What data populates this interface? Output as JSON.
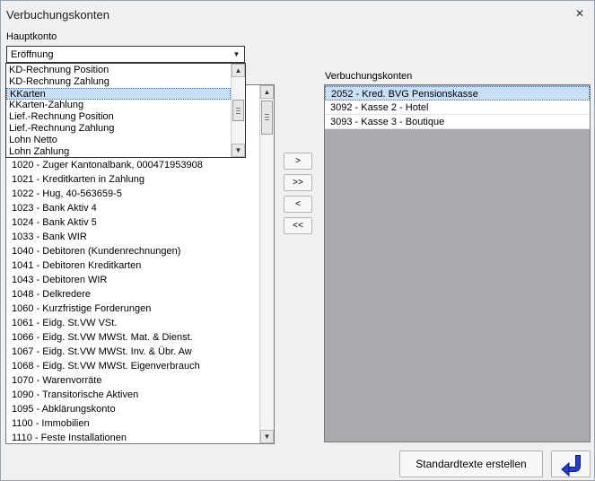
{
  "window": {
    "title": "Verbuchungskonten",
    "close_glyph": "✕"
  },
  "hauptkonto": {
    "label": "Hauptkonto",
    "selected": "Eröffnung",
    "dropdown_items": [
      "KD-Rechnung Position",
      "KD-Rechnung Zahlung",
      "KKarten",
      "KKarten-Zahlung",
      "Lief.-Rechnung Position",
      "Lief.-Rechnung Zahlung",
      "Lohn Netto",
      "Lohn Zahlung"
    ],
    "dropdown_selected_index": 2
  },
  "konten_list": {
    "items": [
      "1020 - Zuger Kantonalbank, 000471953908",
      "1021 - Kreditkarten in Zahlung",
      "1022 - Hug, 40-563659-5",
      "1023 - Bank Aktiv 4",
      "1024 - Bank Aktiv 5",
      "1033 - Bank WIR",
      "1040 - Debitoren (Kundenrechnungen)",
      "1041 - Debitoren Kreditkarten",
      "1043 - Debitoren WIR",
      "1048 - Delkredere",
      "1060 - Kurzfristige Forderungen",
      "1061 - Eidg. St.VW VSt.",
      "1066 - Eidg. St.VW MWSt. Mat. & Dienst.",
      "1067 - Eidg. St.VW MWSt. Inv. & Übr. Aw",
      "1068 - Eidg. St.VW MWSt. Eigenverbrauch",
      "1070 - Warenvorräte",
      "1090 - Transitorische Aktiven",
      "1095 - Abklärungskonto",
      "1100 - Immobilien",
      "1110 - Feste Installationen"
    ]
  },
  "move_buttons": {
    "add": ">",
    "add_all": ">>",
    "remove": "<",
    "remove_all": "<<"
  },
  "verbuchungskonten": {
    "label": "Verbuchungskonten",
    "items": [
      "2052 - Kred. BVG Pensionskasse",
      "3092 - Kasse 2 - Hotel",
      "3093 - Kasse 3 - Boutique"
    ],
    "selected_index": 0
  },
  "buttons": {
    "standardtexte": "Standardtexte erstellen",
    "return_icon": "return-arrow-icon"
  },
  "colors": {
    "selection": "#c9dff6",
    "empty_list_bg": "#a9a9ae",
    "return_icon_blue": "#1f3fd6"
  }
}
